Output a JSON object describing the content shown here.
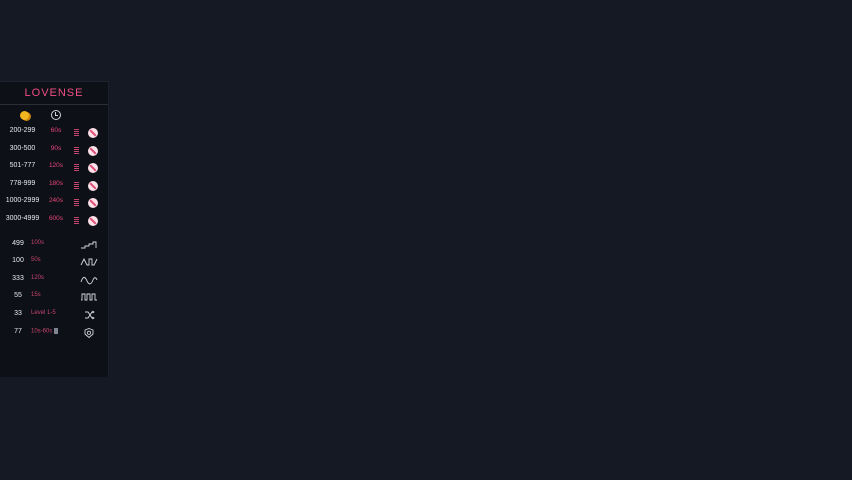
{
  "panel": {
    "logo": "LOVENSE",
    "header_icons": [
      "coins-icon",
      "clock-icon"
    ],
    "tip_levels": [
      {
        "range": "200-299",
        "duration": "60s"
      },
      {
        "range": "300-500",
        "duration": "90s"
      },
      {
        "range": "501-777",
        "duration": "120s"
      },
      {
        "range": "778-999",
        "duration": "180s"
      },
      {
        "range": "1000-2999",
        "duration": "240s"
      },
      {
        "range": "3000-4999",
        "duration": "600s"
      }
    ],
    "special_commands": [
      {
        "value": "499",
        "mode": "100s",
        "icon": "pattern-ramp-icon"
      },
      {
        "value": "100",
        "mode": "50s",
        "icon": "pattern-pulse-icon"
      },
      {
        "value": "333",
        "mode": "120s",
        "icon": "pattern-wave-icon"
      },
      {
        "value": "55",
        "mode": "15s",
        "icon": "pattern-square-icon"
      },
      {
        "value": "33",
        "mode": "Level 1-5",
        "icon": "random-icon"
      },
      {
        "value": "77",
        "mode": "10s-60s",
        "icon": "settings-shield-icon"
      }
    ]
  },
  "colors": {
    "background": "#141923",
    "panel": "#0d1016",
    "accent": "#ef4f83",
    "text": "#e8eaee"
  }
}
